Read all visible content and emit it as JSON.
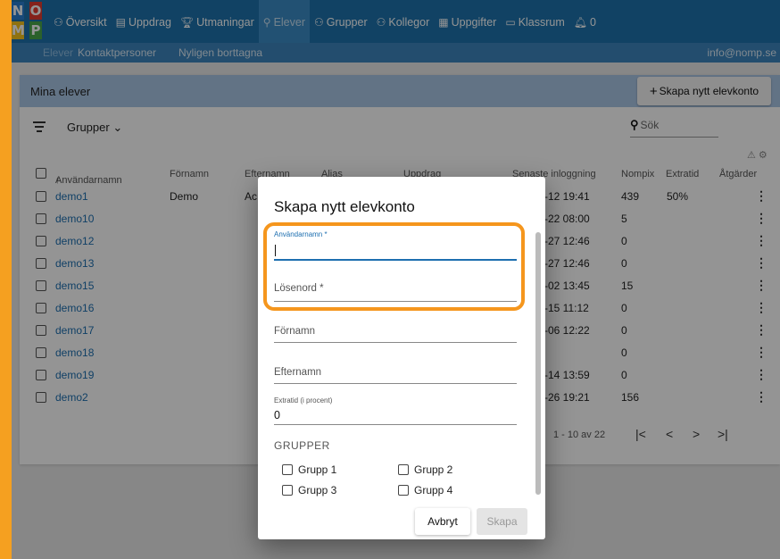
{
  "logo": {
    "letters": [
      "N",
      "O",
      "M",
      "P"
    ],
    "colors": [
      "#2a7fd0",
      "#e33b2f",
      "#f7c51e",
      "#4aa84a"
    ]
  },
  "nav": {
    "items": [
      {
        "icon": "⚇",
        "label": "Översikt"
      },
      {
        "icon": "▤",
        "label": "Uppdrag"
      },
      {
        "icon": "🏆︎",
        "label": "Utmaningar"
      },
      {
        "icon": "⚲",
        "label": "Elever"
      },
      {
        "icon": "⚇",
        "label": "Grupper"
      },
      {
        "icon": "⚇",
        "label": "Kollegor"
      },
      {
        "icon": "▦",
        "label": "Uppgifter"
      },
      {
        "icon": "▭",
        "label": "Klassrum"
      },
      {
        "icon": "🔔︎",
        "label": "0"
      }
    ],
    "active_index": 3
  },
  "subnav": {
    "items": [
      "Elever",
      "Kontaktpersoner",
      "Nyligen borttagna"
    ],
    "email": "info@nomp.se"
  },
  "card": {
    "title": "Mina elever",
    "add_button": "Skapa nytt elevkonto",
    "groups_label": "Grupper",
    "search_placeholder": "Sök"
  },
  "table": {
    "headers": [
      "Användarnamn",
      "Förnamn",
      "Efternamn",
      "Alias",
      "Uppdrag",
      "Senaste inloggning",
      "Nompix",
      "Extratid",
      "Åtgärder"
    ],
    "rows": [
      {
        "username": "demo1",
        "firstname": "Demo",
        "lastname": "Ac",
        "last_login": "-12 19:41",
        "nompix": "439",
        "extratid": "50%"
      },
      {
        "username": "demo10",
        "firstname": "",
        "lastname": "",
        "last_login": "-22 08:00",
        "nompix": "5",
        "extratid": ""
      },
      {
        "username": "demo12",
        "firstname": "",
        "lastname": "",
        "last_login": "-27 12:46",
        "nompix": "0",
        "extratid": ""
      },
      {
        "username": "demo13",
        "firstname": "",
        "lastname": "",
        "last_login": "-27 12:46",
        "nompix": "0",
        "extratid": ""
      },
      {
        "username": "demo15",
        "firstname": "",
        "lastname": "",
        "last_login": "-02 13:45",
        "nompix": "15",
        "extratid": ""
      },
      {
        "username": "demo16",
        "firstname": "",
        "lastname": "",
        "last_login": "-15 11:12",
        "nompix": "0",
        "extratid": ""
      },
      {
        "username": "demo17",
        "firstname": "",
        "lastname": "",
        "last_login": "-06 12:22",
        "nompix": "0",
        "extratid": ""
      },
      {
        "username": "demo18",
        "firstname": "",
        "lastname": "",
        "last_login": "",
        "nompix": "0",
        "extratid": ""
      },
      {
        "username": "demo19",
        "firstname": "",
        "lastname": "",
        "last_login": "-14 13:59",
        "nompix": "0",
        "extratid": ""
      },
      {
        "username": "demo2",
        "firstname": "",
        "lastname": "",
        "last_login": "-26 19:21",
        "nompix": "156",
        "extratid": ""
      }
    ],
    "pagination": "1 - 10 av 22"
  },
  "modal": {
    "title": "Skapa nytt elevkonto",
    "username_label": "Användarnamn *",
    "password_label": "Lösenord *",
    "firstname_label": "Förnamn",
    "lastname_label": "Efternamn",
    "extratime_label": "Extratid (i procent)",
    "extratime_value": "0",
    "groups_heading": "GRUPPER",
    "groups": [
      "Grupp 1",
      "Grupp 2",
      "Grupp 3",
      "Grupp 4"
    ],
    "cancel": "Avbryt",
    "create": "Skapa"
  }
}
